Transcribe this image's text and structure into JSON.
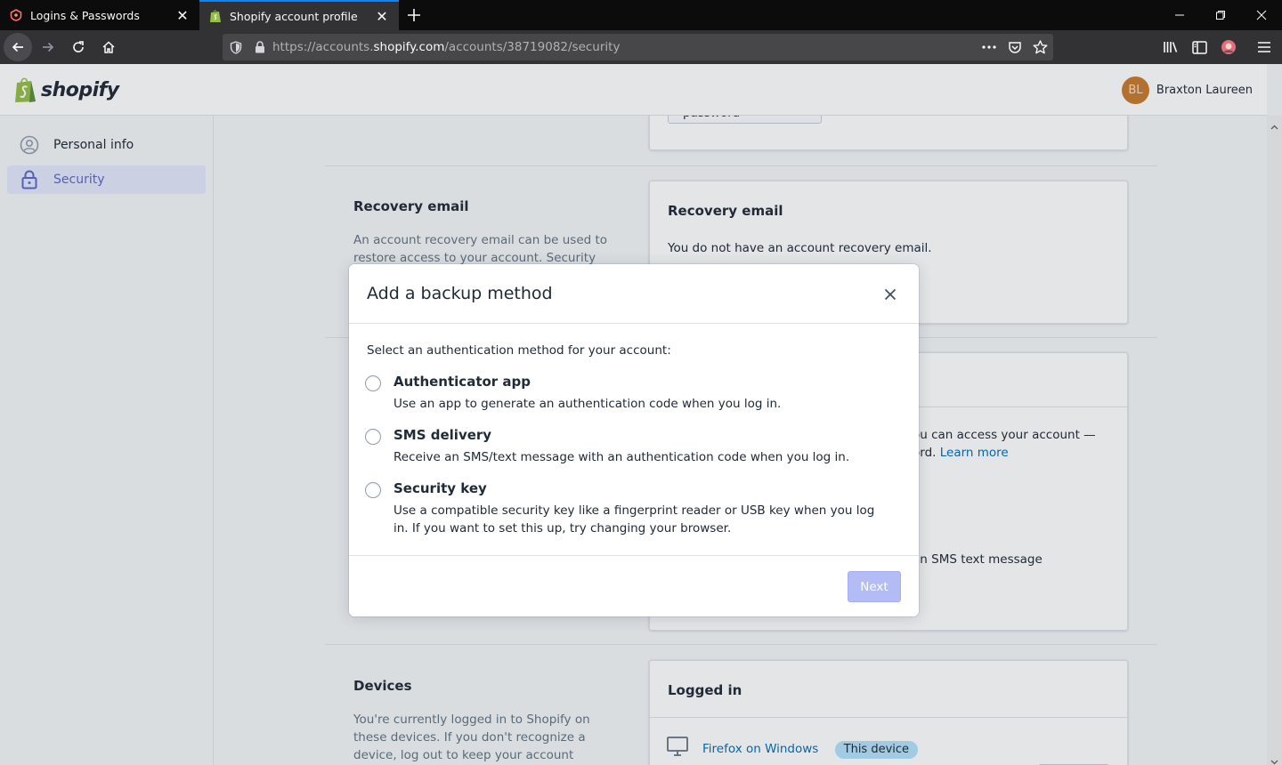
{
  "browser": {
    "tabs": [
      {
        "title": "Logins & Passwords",
        "active": false
      },
      {
        "title": "Shopify account profile",
        "active": true
      }
    ],
    "url": {
      "prefix": "https://accounts.",
      "host": "shopify.com",
      "path": "/accounts/38719082/security"
    }
  },
  "header": {
    "logo_text": "shopify",
    "user": {
      "initials": "BL",
      "name": "Braxton Laureen"
    }
  },
  "sidebar": {
    "items": [
      {
        "label": "Personal info",
        "active": false
      },
      {
        "label": "Security",
        "active": true
      }
    ]
  },
  "password_section": {
    "button_label": "Change your password"
  },
  "recovery_section": {
    "title": "Recovery email",
    "description_line1": "An account recovery email can be used to",
    "description_line2": "restore access to your account. Security",
    "card_title": "Recovery email",
    "card_text": "You do not have an account recovery email."
  },
  "two_step_section": {
    "partial_text_line1": "ou can access your account —",
    "partial_text_line2": "ord.",
    "learn_more": "Learn more",
    "partial_sms_text": "an SMS text message"
  },
  "devices_section": {
    "title": "Devices",
    "description_line1": "You're currently logged in to Shopify on",
    "description_line2": "these devices. If you don't recognize a",
    "description_line3": "device, log out to keep your account",
    "card_title": "Logged in",
    "device_name": "Firefox on Windows",
    "device_badge": "This device"
  },
  "modal": {
    "title": "Add a backup method",
    "prompt": "Select an authentication method for your account:",
    "options": [
      {
        "title": "Authenticator app",
        "description": "Use an app to generate an authentication code when you log in."
      },
      {
        "title": "SMS delivery",
        "description": "Receive an SMS/text message with an authentication code when you log in."
      },
      {
        "title": "Security key",
        "description": "Use a compatible security key like a fingerprint reader or USB key when you log in. If you want to set this up, try changing your browser."
      }
    ],
    "next_label": "Next"
  },
  "colors": {
    "accent": "#5c6ac4",
    "link": "#006fbb",
    "next_disabled": "#b3bcf5",
    "firefox_tab_highlight": "#0a84ff",
    "avatar": "#c77b2e"
  }
}
